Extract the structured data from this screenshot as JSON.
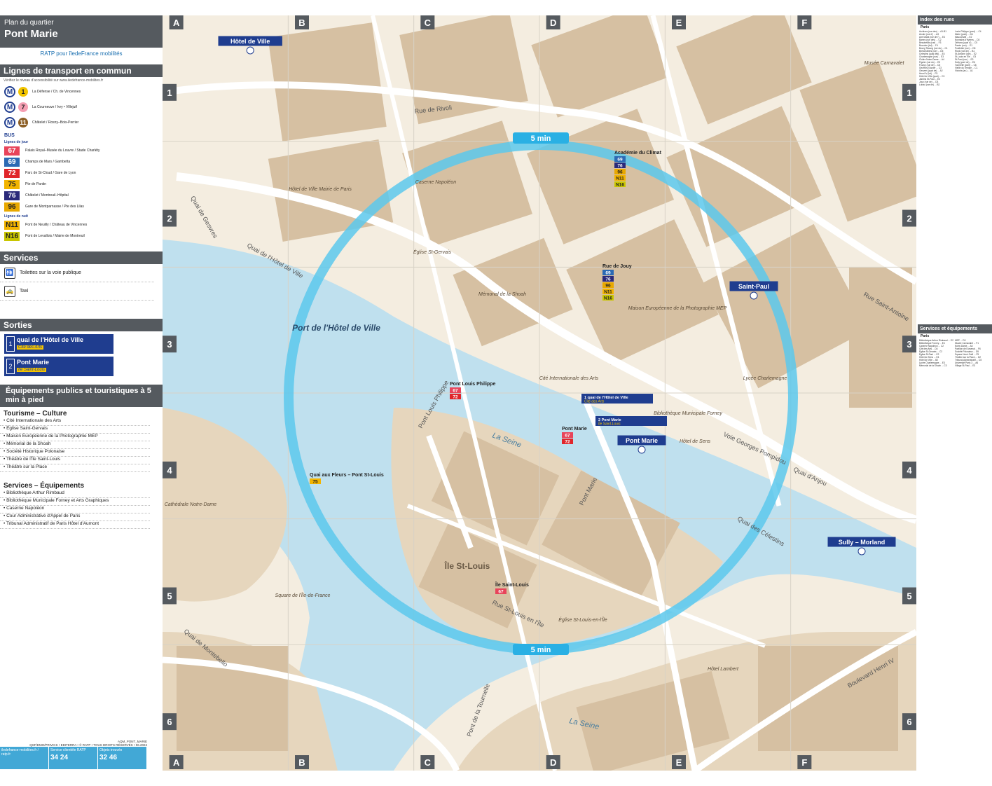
{
  "header": {
    "small": "Plan du quartier",
    "station": "Pont Marie",
    "brand": "RATP pour îledeFrance mobilités"
  },
  "transport": {
    "heading": "Lignes de transport en commun",
    "note": "Vérifiez le niveau d'accessibilité sur www.iledefrance-mobilites.fr",
    "metro": [
      {
        "line": "1",
        "color": "#f2c500",
        "dest": "La Défense / Ch. de Vincennes"
      },
      {
        "line": "7",
        "color": "#f59fb3",
        "dest": "La Courneuve / Ivry • Villejuif"
      },
      {
        "line": "11",
        "color": "#8c5e24",
        "dest": "Châtelet / Rosny–Bois-Perrier"
      }
    ],
    "bus_label": "BUS",
    "day_label": "Lignes de jour",
    "night_label": "Lignes de nuit",
    "bus_day": [
      {
        "num": "67",
        "bg": "#e8445a",
        "fg": "#fff",
        "dest": "Palais Royal–Musée du Louvre / Stade Charléty"
      },
      {
        "num": "69",
        "bg": "#2c6ab4",
        "fg": "#fff",
        "dest": "Champs de Mars / Gambetta"
      },
      {
        "num": "72",
        "bg": "#e0262b",
        "fg": "#fff",
        "dest": "Parc de St-Cloud / Gare de Lyon"
      },
      {
        "num": "75",
        "bg": "#f2b400",
        "fg": "#222",
        "dest": "Pte de Pantin"
      },
      {
        "num": "76",
        "bg": "#2b2a7a",
        "fg": "#fff",
        "dest": "Châtelet / Montreuil–Hôpital"
      },
      {
        "num": "96",
        "bg": "#e8a800",
        "fg": "#222",
        "dest": "Gare de Montparnasse / Pte des Lilas"
      }
    ],
    "bus_night": [
      {
        "num": "N11",
        "bg": "#f2b400",
        "fg": "#222",
        "dest": "Pont de Neuilly / Château de Vincennes"
      },
      {
        "num": "N16",
        "bg": "#c9c600",
        "fg": "#222",
        "dest": "Pont de Levallois / Mairie de Montreuil"
      }
    ]
  },
  "services": {
    "heading": "Services",
    "items": [
      {
        "icon": "toilet-icon",
        "glyph": "🚻",
        "label": "Toilettes sur la voie publique"
      },
      {
        "icon": "taxi-icon",
        "glyph": "🚕",
        "label": "Taxi"
      }
    ]
  },
  "exits": {
    "heading": "Sorties",
    "items": [
      {
        "num": "1",
        "name": "quai de l'Hôtel de Ville",
        "sub": "Cité des Arts"
      },
      {
        "num": "2",
        "name": "Pont Marie",
        "sub": "Île Saint-Louis"
      }
    ]
  },
  "equipment": {
    "heading": "Équipements publics et touristiques à 5 min à pied",
    "culture_label": "Tourisme – Culture",
    "culture": [
      "Cité Internationale des Arts",
      "Église Saint-Gervais",
      "Maison Européenne de la Photographie MEP",
      "Mémorial de la Shoah",
      "Société Historique Polonaise",
      "Théâtre de l'Île Saint-Louis",
      "Théâtre sur la Place"
    ],
    "services_label": "Services – Équipements",
    "services": [
      "Bibliothèque Arthur Rimbaud",
      "Bibliothèque Municipale Forney et Arts Graphiques",
      "Caserne Napoléon",
      "Cour Administrative d'Appel de Paris",
      "Tribunal Administratif de Paris Hôtel d'Aumont"
    ]
  },
  "footer": {
    "credit": "QSF/DMO/PRIVICS • EDITERRA • © RATP • TOUS DROITS RÉSERVÉS • 06.2024",
    "code": "AQM_PONT_MARIE",
    "web": "iledefrance-mobilites.fr / ratp.fr",
    "client": "Service clientèle RATP",
    "client_phone": "34 24",
    "lost": "Objets trouvés",
    "lost_phone": "32 46"
  },
  "map": {
    "cols": [
      "A",
      "B",
      "C",
      "D",
      "E",
      "F"
    ],
    "rows": [
      "1",
      "2",
      "3",
      "4",
      "5",
      "6"
    ],
    "walk_label": "5 min",
    "river": "La Seine",
    "port": "Port de l'Hôtel de Ville",
    "island": "Île St-Louis",
    "streets": [
      "Rue de Rivoli",
      "Quai de l'Hôtel de Ville",
      "Rue Saint-Antoine",
      "Quai des Célestins",
      "Pont Marie",
      "Pont Louis Philippe",
      "Quai de Gesvres",
      "Quai d'Anjou",
      "Rue St-Louis en l'Île",
      "Boulevard Henri IV",
      "Pont de la Tournelle",
      "Quai de Montebello",
      "Voie Georges Pompidou"
    ],
    "stops": [
      {
        "name": "Hôtel de Ville",
        "kind": "metro"
      },
      {
        "name": "Saint-Paul",
        "kind": "metro"
      },
      {
        "name": "Pont Marie",
        "kind": "metro"
      },
      {
        "name": "Sully – Morland",
        "kind": "metro"
      },
      {
        "name": "Académie du Climat",
        "kind": "bus",
        "lines": [
          "69",
          "76",
          "96",
          "N11",
          "N16"
        ]
      },
      {
        "name": "Rue de Jouy",
        "kind": "bus",
        "lines": [
          "69",
          "76",
          "96",
          "N11",
          "N16"
        ]
      },
      {
        "name": "Pont Louis Philippe",
        "kind": "bus",
        "lines": [
          "67",
          "72"
        ]
      },
      {
        "name": "Pont Marie",
        "kind": "bus",
        "lines": [
          "67",
          "72"
        ]
      },
      {
        "name": "Quai aux Fleurs – Pont St-Louis",
        "kind": "bus",
        "lines": [
          "75"
        ]
      },
      {
        "name": "Île Saint-Louis",
        "kind": "bus",
        "lines": [
          "67"
        ]
      }
    ],
    "exits": [
      {
        "num": "1",
        "name": "quai de l'Hôtel de Ville",
        "sub": "Cité des Arts"
      },
      {
        "num": "2",
        "name": "Pont Marie",
        "sub": "Île Saint-Louis"
      }
    ],
    "places": [
      "Hôtel de Ville Mairie de Paris",
      "Église St-Gervais",
      "Mémorial de la Shoah",
      "Maison Européenne de la Photographie MEP",
      "Cité Internationale des Arts",
      "Caserne Napoléon",
      "Bibliothèque Municipale Forney",
      "Lycée Charlemagne",
      "Hôtel de Sens",
      "Musée Carnavalet",
      "Cathédrale Notre-Dame",
      "Hôtel Lambert",
      "Église St-Louis-en-l'Île",
      "Square de l'Île-de-France"
    ]
  },
  "index": {
    "streets_heading": "Index des rues",
    "services_heading": "Services et équipements",
    "city": "Paris",
    "col1": [
      "Archives (rue des) ... A1-B1",
      "Arcole (rue d') ... A3",
      "Ave Maria (rue de l') ... E4",
      "Barres (rue des) ... C2",
      "Beautreillis (rue) ... F3",
      "Bourdon (bd) ... F4",
      "Bourg Tibourg (rue du) ... C1",
      "Bretonvilliers (rue) ... D5",
      "Celestins (quai des) ... E4",
      "Charlemagne (rue) ... E3",
      "Cloître Notre-Dame ... A4",
      "Figuier (rue du) ... E3",
      "Fourcy (rue de) ... D2",
      "Geoffroy l'Asnier ... C3",
      "Gesvres (quai de) ... A2",
      "Henri IV (bd) ... F5",
      "Hôtel de Ville (quai) ... C3",
      "Jardins St-Paul ... E3",
      "Jouy (rue de) ... D3",
      "Lobau (rue de) ... B2"
    ],
    "col2": [
      "Louis Philippe (pont) ... C4",
      "Marie (pont) ... D4",
      "Mauconseil ... E2",
      "Nonnains d'Hyères ... D3",
      "Orléans (quai d') ... C5",
      "Pavée (rue) ... E1",
      "Poulletier (rue) ... D5",
      "Rivoli (rue de) ... B1",
      "St-Antoine (rue) ... E2",
      "St-Louis en l'Île ... C5",
      "St-Paul (rue) ... E3",
      "Sully (pont de) ... E6",
      "Tournelle (pont) ... C6",
      "Vieille du Temple ... C1",
      "Victoria (av.) ... A1"
    ],
    "svc_col1": [
      "Bibliothèque Arthur Rimbaud ... E2",
      "Bibliothèque Forney ... E4",
      "Caserne Napoléon ... C2",
      "Cité des Arts ... D4",
      "Église St-Gervais ... C2",
      "Église St-Paul ... E2",
      "Hôtel de Sens ... E4",
      "Hôtel de Ville ... B2",
      "Lycée Charlemagne ... E3",
      "Mémorial de la Shoah ... C3"
    ],
    "svc_col2": [
      "MEP ... D3",
      "Musée Carnavalet ... F1",
      "Notre-Dame ... A4",
      "Pavillon de l'Arsenal ... F6",
      "Société Polonaise ... D5",
      "Square Henri Galli ... F5",
      "Théâtre sur la Place ... D2",
      "Tribunal Administratif ... D3",
      "Université Paris 3 ... A6",
      "Village St-Paul ... E3"
    ]
  }
}
